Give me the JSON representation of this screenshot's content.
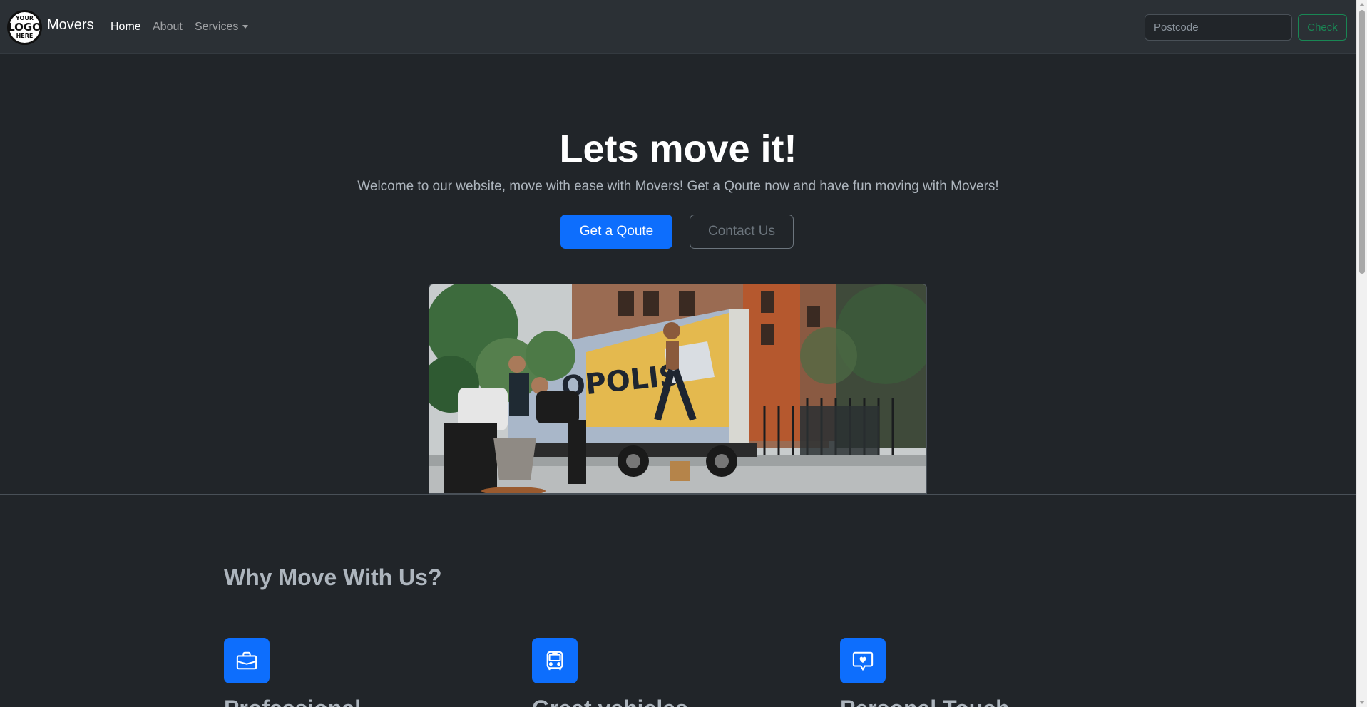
{
  "nav": {
    "logo": {
      "line1": "YOUR",
      "line2": "LOGO",
      "line3": "HERE"
    },
    "brand": "Movers",
    "links": [
      {
        "label": "Home",
        "active": true
      },
      {
        "label": "About",
        "active": false
      },
      {
        "label": "Services",
        "active": false,
        "dropdown": true
      }
    ],
    "search": {
      "placeholder": "Postcode",
      "value": ""
    },
    "check_label": "Check"
  },
  "hero": {
    "title": "Lets move it!",
    "lead": "Welcome to our website, move with ease with Movers! Get a Qoute now and have fun moving with Movers!",
    "primary_button": "Get a Qoute",
    "secondary_button": "Contact Us",
    "image_van_text": "OPOLIS"
  },
  "why": {
    "title": "Why Move With Us?",
    "features": [
      {
        "icon": "briefcase-icon",
        "heading": "Professional"
      },
      {
        "icon": "bus-icon",
        "heading": "Great vehicles"
      },
      {
        "icon": "chat-heart-icon",
        "heading": "Personal Touch"
      }
    ]
  },
  "colors": {
    "background": "#212529",
    "navbar": "#2b3035",
    "primary": "#0d6efd",
    "success": "#198754",
    "secondary": "#6c757d"
  }
}
